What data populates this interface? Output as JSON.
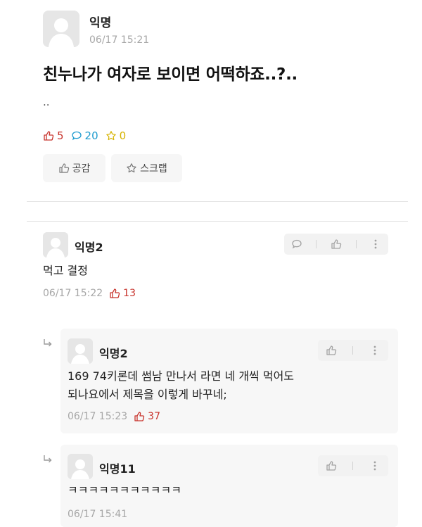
{
  "post": {
    "author": "익명",
    "time": "06/17 15:21",
    "title": "친누나가 여자로 보이면 어떡하죠..?..",
    "body": "..",
    "stats": {
      "likes": "5",
      "comments": "20",
      "scraps": "0"
    },
    "buttons": {
      "empathy": "공감",
      "scrap": "스크랩"
    }
  },
  "comments": [
    {
      "author": "익명2",
      "text": "먹고 결정",
      "time": "06/17 15:22",
      "likes": "13"
    }
  ],
  "replies": [
    {
      "author": "익명2",
      "text_line1": "169 74키론데 썸남 만나서 라면 네 개씩 먹어도",
      "text_line2": "되나요에서 제목을 이렇게 바꾸네;",
      "time": "06/17 15:23",
      "likes": "37"
    },
    {
      "author": "익명11",
      "text": "ㅋㅋㅋㅋㅋㅋㅋㅋㅋㅋㅋ",
      "time": "06/17 15:41"
    }
  ],
  "colors": {
    "like": "#c8342d",
    "comment": "#1f9ccf",
    "scrap": "#d6b300"
  }
}
